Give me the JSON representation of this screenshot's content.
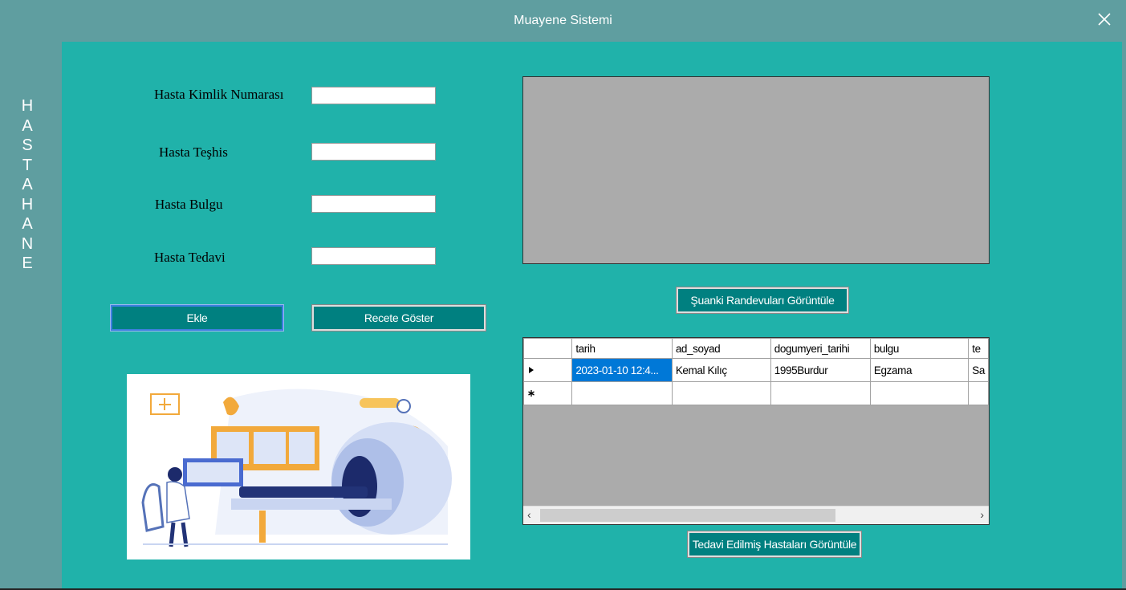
{
  "window": {
    "title": "Muayene Sistemi"
  },
  "sidebar": {
    "letters": [
      "H",
      "A",
      "S",
      "T",
      "A",
      "H",
      "A",
      "N",
      "E"
    ]
  },
  "form": {
    "kimlik_label": "Hasta Kimlik Numarası",
    "teshis_label": "Hasta Teşhis",
    "bulgu_label": "Hasta Bulgu",
    "tedavi_label": "Hasta Tedavi",
    "kimlik_value": "",
    "teshis_value": "",
    "bulgu_value": "",
    "tedavi_value": ""
  },
  "buttons": {
    "ekle": "Ekle",
    "recete": "Recete Göster",
    "randevu": "Şuanki Randevuları Görüntüle",
    "tedavi": "Tedavi Edilmiş Hastaları Görüntüle"
  },
  "grid": {
    "columns": [
      "tarih",
      "ad_soyad",
      "dogumyeri_tarihi",
      "bulgu",
      "te"
    ],
    "rows": [
      [
        "2023-01-10 12:4...",
        "Kemal   Kılıç",
        "1995Burdur",
        "Egzama",
        "Sa"
      ]
    ]
  },
  "colors": {
    "titlebar": "#5f9ea0",
    "panel": "#20b2aa",
    "button": "#008080",
    "grid_background": "#ababab",
    "selection": "#0078d7"
  }
}
